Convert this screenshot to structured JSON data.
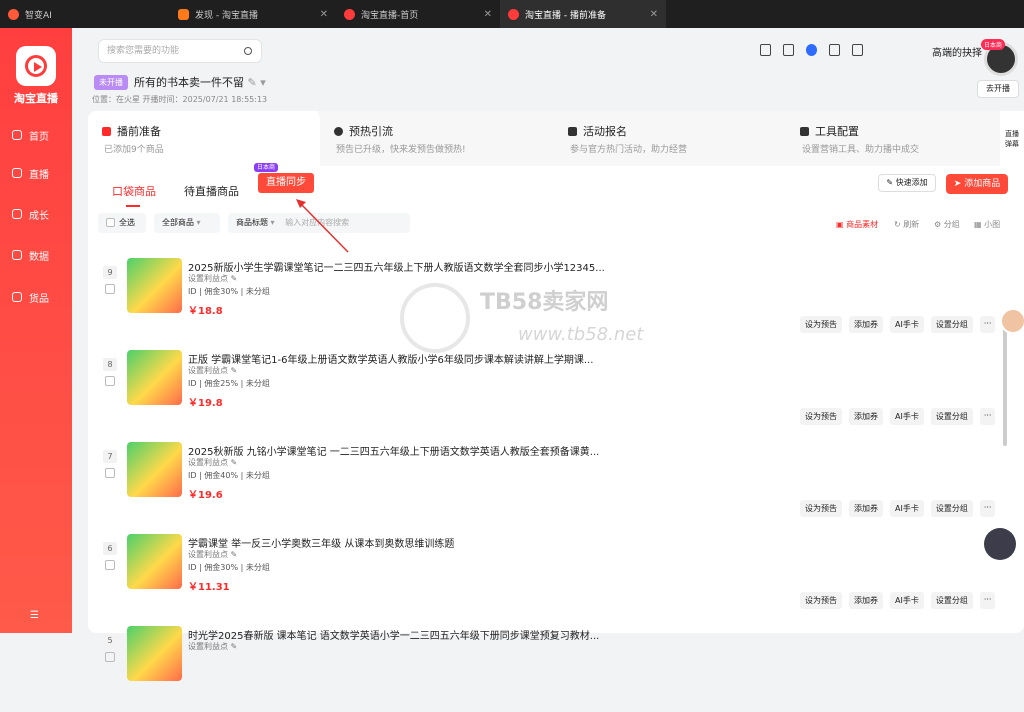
{
  "tabs": [
    {
      "label": "智变AI",
      "icon_color": "#ff5a3a"
    },
    {
      "label": "发现 - 淘宝直播",
      "icon_color": "#ff7a1a"
    },
    {
      "label": "淘宝直播-首页",
      "icon_color": "#ff3b3b"
    },
    {
      "label": "淘宝直播 - 播前准备",
      "icon_color": "#ff3b3b"
    }
  ],
  "sidebar": {
    "brand": "淘宝直播",
    "items": [
      {
        "label": "首页"
      },
      {
        "label": "直播"
      },
      {
        "label": "成长"
      },
      {
        "label": "数据"
      },
      {
        "label": "货品"
      }
    ]
  },
  "header": {
    "search_placeholder": "搜索您需要的功能",
    "user": "高端的抉择",
    "badge": "日本商",
    "go_live": "去开播",
    "status": "未开播",
    "title": "所有的书本卖一件不留",
    "meta": "位置：在火星   开播时间：2025/07/21 18:55:13"
  },
  "steps": [
    {
      "title": "播前准备",
      "desc": "已添加9个商品"
    },
    {
      "title": "预热引流",
      "desc": "预告已升级，快来发预告做预热!"
    },
    {
      "title": "活动报名",
      "desc": "参与官方热门活动，助力经营"
    },
    {
      "title": "工具配置",
      "desc": "设置营销工具、助力播中成交"
    }
  ],
  "side_tab": {
    "line1": "直播",
    "line2": "弹幕"
  },
  "subtabs": {
    "pocket": "口袋商品",
    "waiting": "待直播商品",
    "sync": "直播同步",
    "sync_badge": "日本商"
  },
  "actions": {
    "quick": "快速添加",
    "add": "添加商品"
  },
  "filters": {
    "all": "全选",
    "all_goods": "全部商品",
    "title": "商品标题",
    "placeholder": "输入对应内容搜索"
  },
  "right_tools": {
    "material": "商品素材",
    "refresh": "刷新",
    "group": "分组",
    "small": "小图"
  },
  "products": [
    {
      "num": "9",
      "name": "2025新版小学生学霸课堂笔记一二三四五六年级上下册人教版语文数学全套同步小学12345...",
      "point": "设置利益点",
      "meta": "ID  |  佣金30%  |  未分组",
      "price": "￥18.8"
    },
    {
      "num": "8",
      "name": "正版 学霸课堂笔记1-6年级上册语文数学英语人教版小学6年级同步课本解读讲解上学期课...",
      "point": "设置利益点",
      "meta": "ID  |  佣金25%  |  未分组",
      "price": "￥19.8"
    },
    {
      "num": "7",
      "name": "2025秋新版 九铭小学课堂笔记 一二三四五六年级上下册语文数学英语人教版全套预备课黄...",
      "point": "设置利益点",
      "meta": "ID  |  佣金40%  |  未分组",
      "price": "￥19.6"
    },
    {
      "num": "6",
      "name": "学霸课堂 举一反三小学奥数三年级 从课本到奥数思维训练题",
      "point": "设置利益点",
      "meta": "ID  |  佣金30%  |  未分组",
      "price": "￥11.31"
    },
    {
      "num": "5",
      "name": "时光学2025春新版 课本笔记 语文数学英语小学一二三四五六年级下册同步课堂预复习教材...",
      "point": "设置利益点",
      "meta": "",
      "price": ""
    }
  ],
  "row_actions": [
    "设为预告",
    "添加券",
    "AI手卡",
    "设置分组",
    "···"
  ],
  "watermark": {
    "main": "TB58卖家网",
    "sub": "www.tb58.net"
  }
}
